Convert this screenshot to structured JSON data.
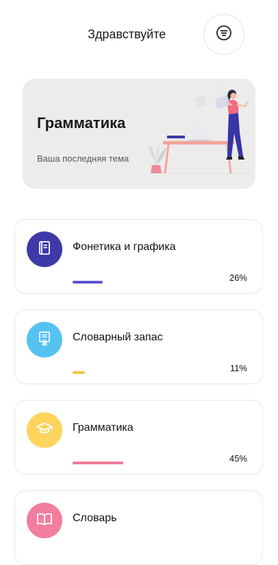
{
  "header": {
    "greeting": "Здравствуйте",
    "menu_icon": "menu-lines-icon"
  },
  "hero": {
    "title": "Грамматика",
    "subtitle": "Ваша последняя тема"
  },
  "topics": [
    {
      "title": "Фонетика и графика",
      "percent_label": "26%",
      "progress": 0.26,
      "color": "#3d3aa8",
      "bar_color": "#5a56c9",
      "icon": "book-icon"
    },
    {
      "title": "Словарный запас",
      "percent_label": "11%",
      "progress": 0.11,
      "color": "#56c2f2",
      "bar_color": "#f0c645",
      "icon": "certificate-icon"
    },
    {
      "title": "Грамматика",
      "percent_label": "45%",
      "progress": 0.45,
      "color": "#ffd45e",
      "bar_color": "#ee7a98",
      "icon": "graduation-cap-icon"
    },
    {
      "title": "Словарь",
      "percent_label": "",
      "progress": null,
      "color": "#f27d9f",
      "bar_color": "#f27d9f",
      "icon": "open-book-icon"
    }
  ]
}
